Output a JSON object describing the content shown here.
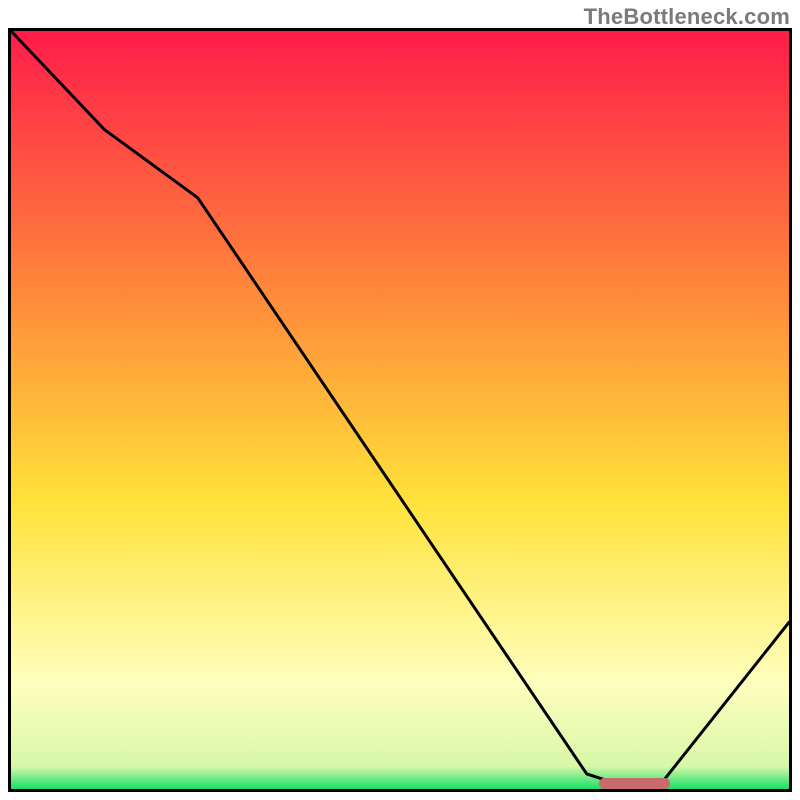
{
  "watermark": "TheBottleneck.com",
  "colors": {
    "top": "#ff1c4a",
    "mid_orange": "#ff8a3a",
    "mid_yellow": "#ffe23a",
    "pale_yellow": "#ffffbe",
    "bottom_green": "#17e06a",
    "marker": "#c96a6d",
    "border": "#000000"
  },
  "chart_data": {
    "type": "line",
    "title": "",
    "xlabel": "",
    "ylabel": "",
    "xlim": [
      0,
      100
    ],
    "ylim": [
      0,
      100
    ],
    "x": [
      0,
      12,
      24,
      74,
      80,
      83,
      100
    ],
    "y": [
      100,
      87,
      78,
      2,
      0,
      0,
      22
    ],
    "marker_x_range": [
      75,
      84
    ],
    "gradient_stops": [
      {
        "pos": 0.0,
        "hex": "#ff1c4a"
      },
      {
        "pos": 0.35,
        "hex": "#ff8a3a"
      },
      {
        "pos": 0.62,
        "hex": "#ffe23a"
      },
      {
        "pos": 0.86,
        "hex": "#ffffbe"
      },
      {
        "pos": 0.97,
        "hex": "#d8f7a8"
      },
      {
        "pos": 1.0,
        "hex": "#17e06a"
      }
    ]
  }
}
